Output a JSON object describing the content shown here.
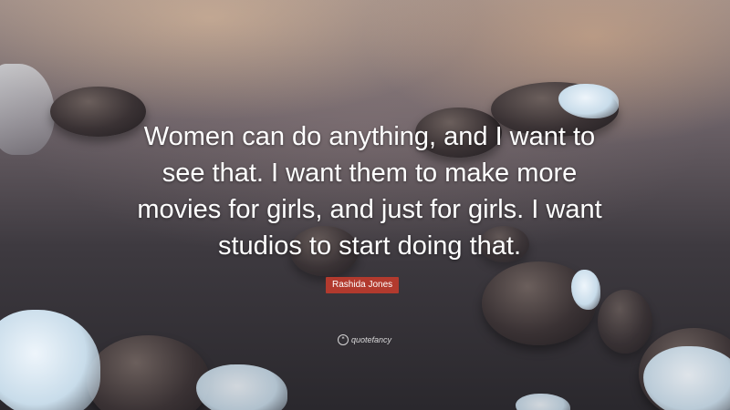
{
  "quote": {
    "text": "Women can do anything, and I want to see that. I want them to make more movies for girls, and just for girls. I want studios to start doing that.",
    "author": "Rashida Jones"
  },
  "brand": {
    "name": "quotefancy",
    "icon": "quotefancy-logo-icon"
  },
  "colors": {
    "author_badge": "#b23a2e",
    "text": "#ffffff"
  }
}
